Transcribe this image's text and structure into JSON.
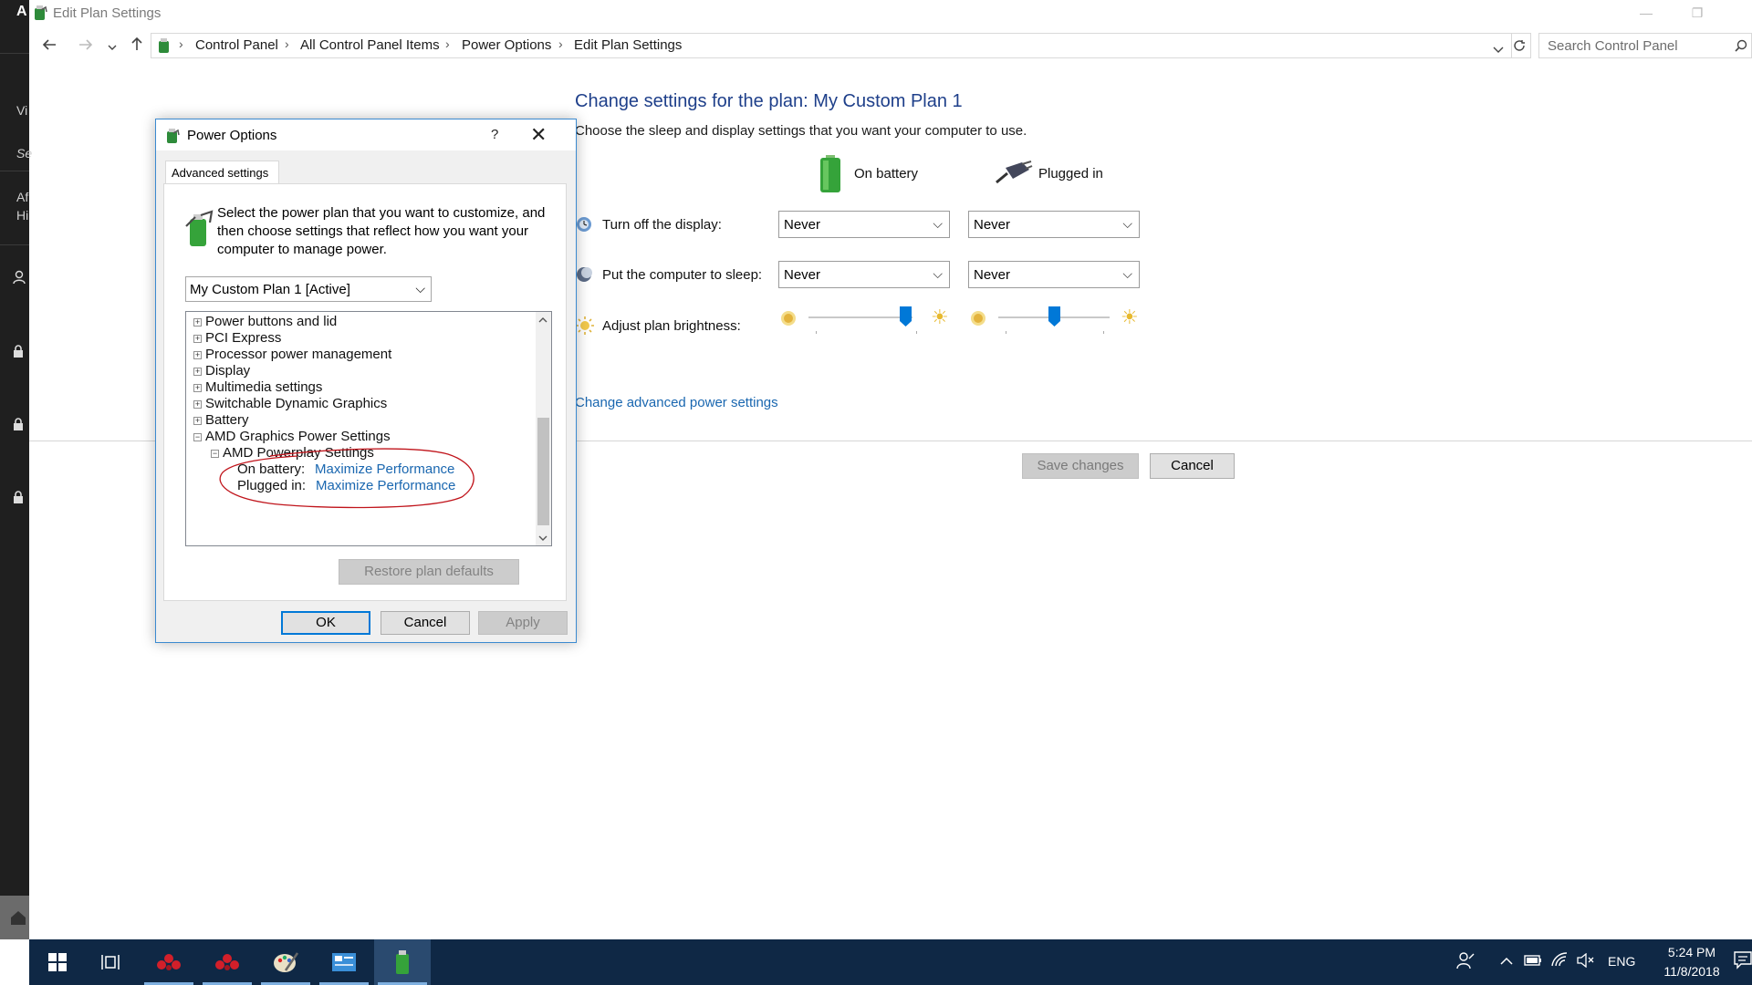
{
  "window": {
    "title": "Edit Plan Settings",
    "minimize_glyph": "—",
    "restore_glyph": "❐",
    "icon": "power-options-icon"
  },
  "left_strip": {
    "fragments": [
      "Vi",
      "Se",
      "Af",
      "Hi"
    ]
  },
  "address": {
    "crumbs": [
      "Control Panel",
      "All Control Panel Items",
      "Power Options",
      "Edit Plan Settings"
    ],
    "search_placeholder": "Search Control Panel"
  },
  "page": {
    "title": "Change settings for the plan: My Custom Plan 1",
    "subtitle": "Choose the sleep and display settings that you want your computer to use.",
    "col_battery": "On battery",
    "col_plugged": "Plugged in",
    "rows": [
      {
        "label": "Turn off the display:",
        "battery": "Never",
        "plugged": "Never"
      },
      {
        "label": "Put the computer to sleep:",
        "battery": "Never",
        "plugged": "Never"
      }
    ],
    "brightness_label": "Adjust plan brightness:",
    "brightness_battery_percent": 93,
    "brightness_plugged_percent": 50,
    "advanced_link": "Change advanced power settings",
    "save_label": "Save changes",
    "cancel_label": "Cancel"
  },
  "dialog": {
    "title": "Power Options",
    "help_glyph": "?",
    "close_glyph": "✕",
    "tab": "Advanced settings",
    "description": "Select the power plan that you want to customize, and then choose settings that reflect how you want your computer to manage power.",
    "plan_selected": "My Custom Plan 1 [Active]",
    "tree": [
      {
        "label": "Power buttons and lid",
        "expanded": false
      },
      {
        "label": "PCI Express",
        "expanded": false
      },
      {
        "label": "Processor power management",
        "expanded": false
      },
      {
        "label": "Display",
        "expanded": false
      },
      {
        "label": "Multimedia settings",
        "expanded": false
      },
      {
        "label": "Switchable Dynamic Graphics",
        "expanded": false
      },
      {
        "label": "Battery",
        "expanded": false
      },
      {
        "label": "AMD Graphics Power Settings",
        "expanded": true
      }
    ],
    "subgroup": "AMD Powerplay Settings",
    "on_battery_label": "On battery:",
    "on_battery_value": "Maximize Performance",
    "plugged_label": "Plugged in:",
    "plugged_value": "Maximize Performance",
    "expand_glyph": "+",
    "collapse_glyph": "−",
    "restore_label": "Restore plan defaults",
    "ok_label": "OK",
    "cancel_label": "Cancel",
    "apply_label": "Apply",
    "annotation_color": "#c0141b"
  },
  "taskbar": {
    "items": [
      "start-icon",
      "task-view-icon",
      "red-app-icon",
      "red-app-2-icon",
      "paint-icon",
      "control-panel-icon",
      "power-options-icon"
    ],
    "language": "ENG",
    "time": "5:24 PM",
    "date": "11/8/2018"
  },
  "colors": {
    "accent": "#0078d7",
    "link": "#1a67b0",
    "title_blue": "#1e3f8a",
    "taskbar": "#0f2845"
  }
}
